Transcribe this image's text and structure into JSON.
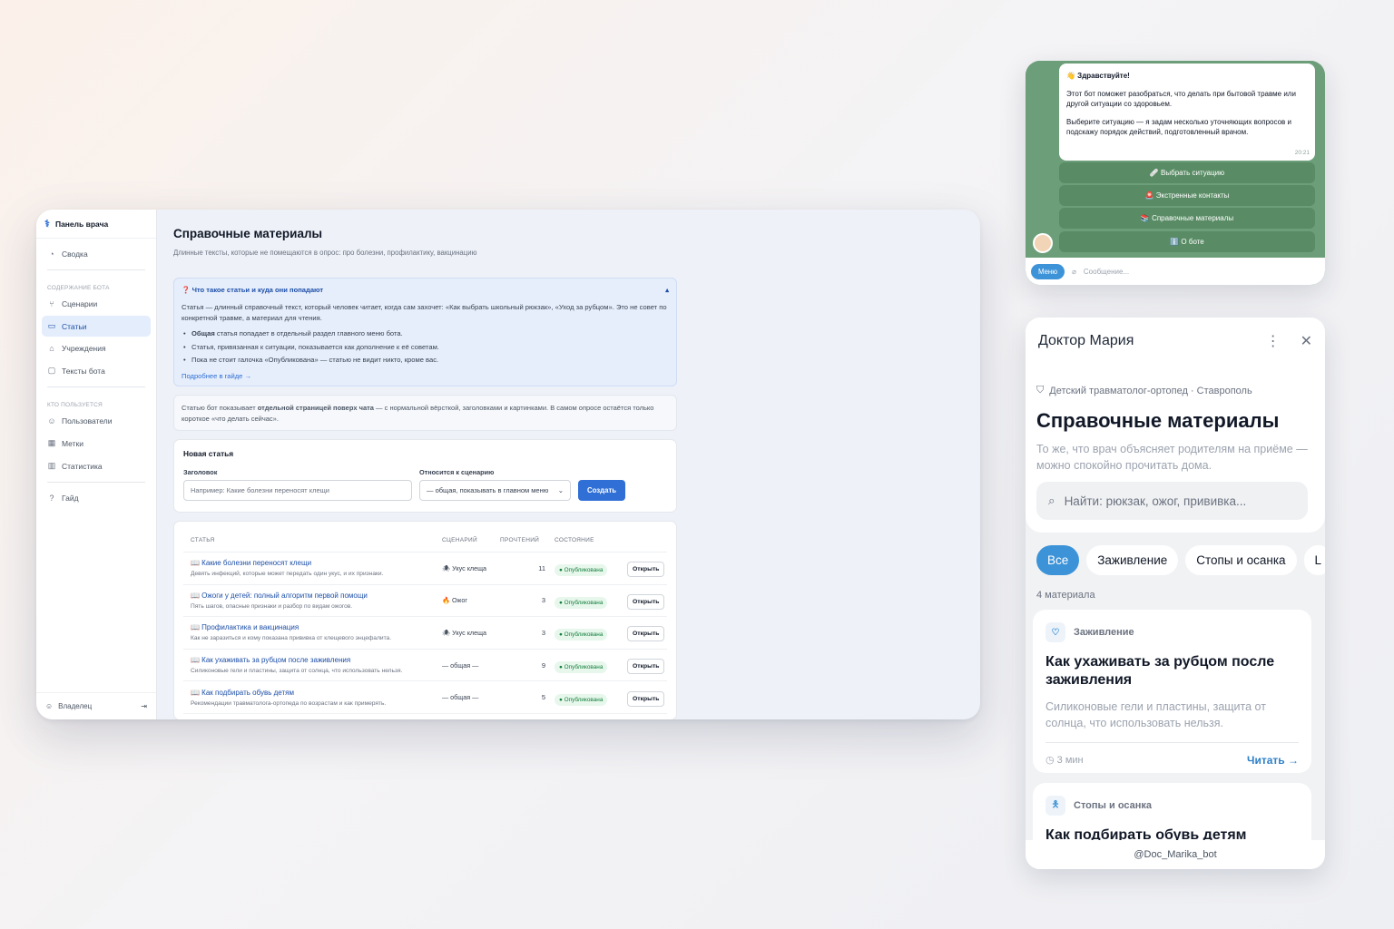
{
  "sidebar": {
    "brand": "Панель врача",
    "summary": "Сводка",
    "section_content": "Содержание бота",
    "items_content": [
      "Сценарии",
      "Статьи",
      "Учреждения",
      "Тексты бота"
    ],
    "section_users": "Кто пользуется",
    "items_users": [
      "Пользователи",
      "Метки",
      "Статистика"
    ],
    "guide": "Гайд",
    "owner": "Владелец"
  },
  "main": {
    "title": "Справочные материалы",
    "subtitle": "Длинные тексты, которые не помещаются в опрос: про болезни, профилактику, вакцинацию",
    "info": {
      "heading": "❓ Что такое статьи и куда они попадают",
      "text": "Статья — длинный справочный текст, который человек читает, когда сам захочет: «Как выбрать школьный рюкзак», «Уход за рубцом». Это не совет по конкретной травме, а материал для чтения.",
      "bullet1_bold": "Общая",
      "bullet1_rest": " статья попадает в отдельный раздел главного меню бота.",
      "bullet2": "Статья, привязанная к ситуации, показывается как дополнение к её советам.",
      "bullet3": "Пока не стоит галочка «Опубликована» — статью не видит никто, кроме вас.",
      "more": "Подробнее в гайде →"
    },
    "note": {
      "pre": "Статью бот показывает ",
      "bold": "отдельной страницей поверх чата",
      "post": " — с нормальной вёрсткой, заголовками и картинками. В самом опросе остаётся только короткое «что делать сейчас»."
    },
    "form": {
      "title": "Новая статья",
      "label_title": "Заголовок",
      "placeholder": "Например: Какие болезни переносят клещи",
      "label_scenario": "Относится к сценарию",
      "scenario_value": "— общая, показывать в главном меню",
      "create": "Создать"
    },
    "table": {
      "headers": [
        "Статья",
        "Сценарий",
        "Прочтений",
        "Состояние"
      ],
      "rows": [
        {
          "title": "📖 Какие болезни переносят клещи",
          "desc": "Девять инфекций, которые может передать один укус, и их признаки.",
          "scenario": "🕷 Укус клеща",
          "reads": "11",
          "status": "● Опубликована",
          "action": "Открыть"
        },
        {
          "title": "📖 Ожоги у детей: полный алгоритм первой помощи",
          "desc": "Пять шагов, опасные признаки и разбор по видам ожогов.",
          "scenario": "🔥 Ожог",
          "reads": "3",
          "status": "● Опубликована",
          "action": "Открыть"
        },
        {
          "title": "📖 Профилактика и вакцинация",
          "desc": "Как не заразиться и кому показана прививка от клещевого энцефалита.",
          "scenario": "🕷 Укус клеща",
          "reads": "3",
          "status": "● Опубликована",
          "action": "Открыть"
        },
        {
          "title": "📖 Как ухаживать за рубцом после заживления",
          "desc": "Силиконовые гели и пластины, защита от солнца, что использовать нельзя.",
          "scenario": "— общая —",
          "reads": "9",
          "status": "● Опубликована",
          "action": "Открыть"
        },
        {
          "title": "📖 Как подбирать обувь детям",
          "desc": "Рекомендации травматолога-ортопеда по возрастам и как примерять.",
          "scenario": "— общая —",
          "reads": "5",
          "status": "● Опубликована",
          "action": "Открыть"
        }
      ]
    }
  },
  "telegram": {
    "greeting": "👋 Здравствуйте!",
    "p1": "Этот бот поможет разобраться, что делать при бытовой травме или другой ситуации со здоровьем.",
    "p2": "Выберите ситуацию — я задам несколько уточняющих вопросов и подскажу порядок действий, подготовленный врачом.",
    "time": "20:21",
    "buttons": [
      "🩹 Выбрать ситуацию",
      "🚨 Экстренные контакты",
      "📚 Справочные материалы",
      "ℹ️ О боте"
    ],
    "menu": "Меню",
    "placeholder": "Сообщение..."
  },
  "mobile": {
    "header": "Доктор Мария",
    "specialty": "Детский травматолог-ортопед · Ставрополь",
    "title": "Справочные материалы",
    "subtitle": "То же, что врач объясняет родителям на приёме — можно спокойно прочитать дома.",
    "search_placeholder": "Найти: рюкзак, ожог, прививка...",
    "chips": [
      "Все",
      "Заживление",
      "Стопы и осанка",
      "L"
    ],
    "count": "4 материала",
    "card1": {
      "category": "Заживление",
      "title": "Как ухаживать за рубцом после заживления",
      "desc": "Силиконовые гели и пластины, защита от солнца, что использовать нельзя.",
      "time": "3 мин",
      "read": "Читать →"
    },
    "card2": {
      "category": "Стопы и осанка",
      "title": "Как подбирать обувь детям"
    },
    "bot": "@Doc_Marika_bot"
  }
}
